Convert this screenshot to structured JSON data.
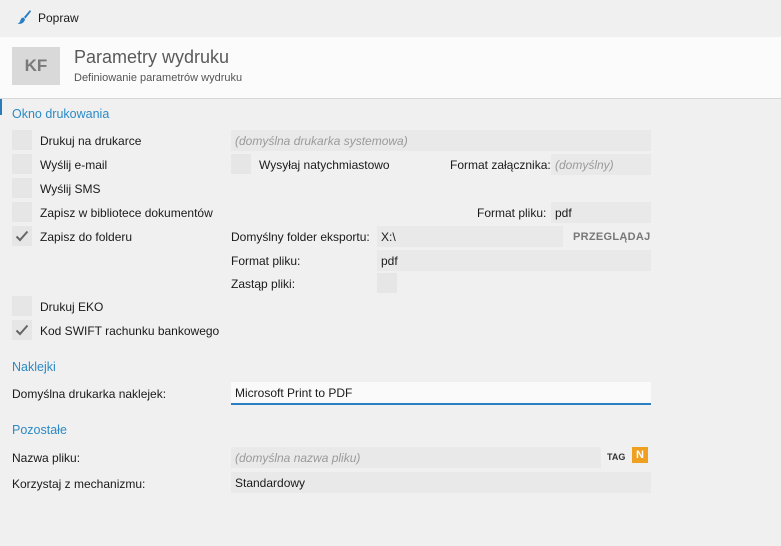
{
  "toolbar": {
    "fix_label": "Popraw"
  },
  "header": {
    "logo": "KF",
    "title": "Parametry wydruku",
    "subtitle": "Definiowanie parametrów wydruku"
  },
  "print_window": {
    "section_title": "Okno drukowania",
    "print_on_printer": {
      "label": "Drukuj na drukarce",
      "checked": false,
      "placeholder": "(domyślna drukarka systemowa)"
    },
    "send_email": {
      "label": "Wyślij e-mail",
      "checked": false
    },
    "send_immediately": {
      "label": "Wysyłaj natychmiastowo",
      "checked": false
    },
    "attachment_format": {
      "label": "Format załącznika:",
      "placeholder": "(domyślny)"
    },
    "send_sms": {
      "label": "Wyślij SMS",
      "checked": false
    },
    "save_library": {
      "label": "Zapisz w bibliotece dokumentów",
      "checked": false
    },
    "library_file_format": {
      "label": "Format pliku:",
      "value": "pdf"
    },
    "save_folder": {
      "label": "Zapisz do folderu",
      "checked": true
    },
    "export_folder": {
      "label": "Domyślny folder eksportu:",
      "value": "X:\\",
      "browse": "PRZEGLĄDAJ"
    },
    "folder_file_format": {
      "label": "Format pliku:",
      "value": "pdf"
    },
    "overwrite": {
      "label": "Zastąp pliki:",
      "checked": false
    },
    "eko": {
      "label": "Drukuj EKO",
      "checked": false
    },
    "swift": {
      "label": "Kod SWIFT rachunku bankowego",
      "checked": true
    }
  },
  "labels_section": {
    "section_title": "Naklejki",
    "default_printer": {
      "label": "Domyślna drukarka naklejek:",
      "value": "Microsoft Print to PDF"
    }
  },
  "other": {
    "section_title": "Pozostałe",
    "file_name": {
      "label": "Nazwa pliku:",
      "placeholder": "(domyślna nazwa pliku)",
      "tag": "TAG",
      "n_button": "N"
    },
    "mechanism": {
      "label": "Korzystaj z mechanizmu:",
      "value": "Standardowy"
    }
  },
  "colors": {
    "accent": "#2b8ac6",
    "n_button": "#f0a020",
    "checkmark": "#666666"
  }
}
